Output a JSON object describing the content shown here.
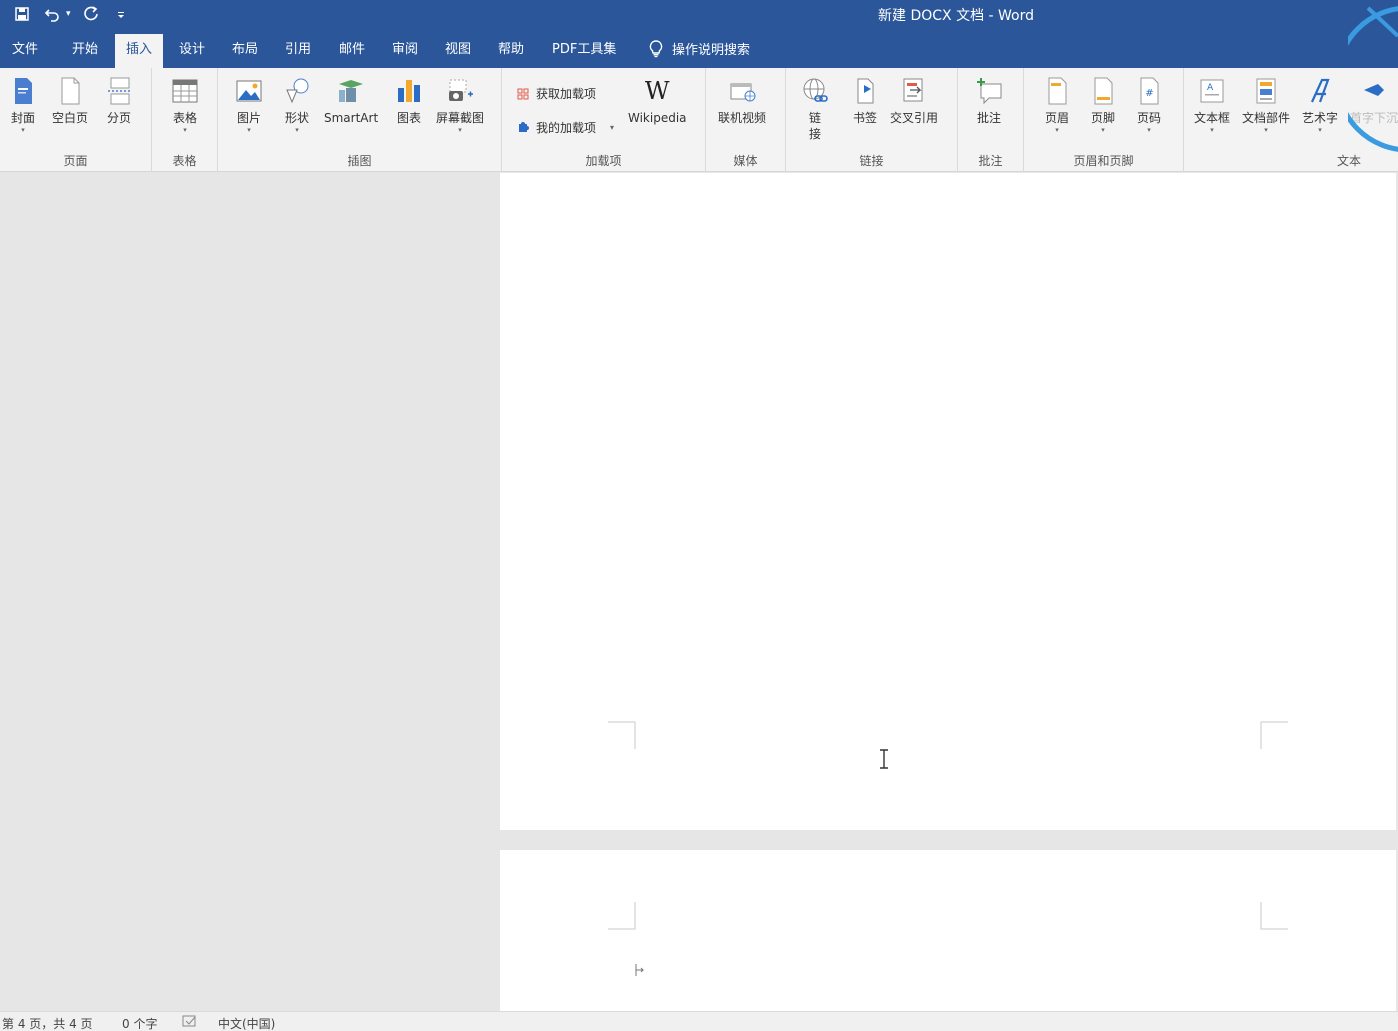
{
  "window": {
    "title": "新建 DOCX 文档  -  Word"
  },
  "quick_access": [
    {
      "name": "save-icon"
    },
    {
      "name": "undo-icon"
    },
    {
      "name": "redo-icon"
    },
    {
      "name": "customize-qat-icon"
    }
  ],
  "tabs": [
    {
      "label": "文件",
      "active": false
    },
    {
      "label": "开始",
      "active": false
    },
    {
      "label": "插入",
      "active": true
    },
    {
      "label": "设计",
      "active": false
    },
    {
      "label": "布局",
      "active": false
    },
    {
      "label": "引用",
      "active": false
    },
    {
      "label": "邮件",
      "active": false
    },
    {
      "label": "审阅",
      "active": false
    },
    {
      "label": "视图",
      "active": false
    },
    {
      "label": "帮助",
      "active": false
    },
    {
      "label": "PDF工具集",
      "active": false
    }
  ],
  "tell_me": {
    "label": "操作说明搜索",
    "icon": "lightbulb-icon"
  },
  "ribbon": {
    "groups": {
      "pages": {
        "label": "页面",
        "buttons": [
          {
            "label": "封面",
            "icon": "cover-page-icon",
            "dropdown": true
          },
          {
            "label": "空白页",
            "icon": "blank-page-icon",
            "dropdown": false
          },
          {
            "label": "分页",
            "icon": "page-break-icon",
            "dropdown": false
          }
        ]
      },
      "tables": {
        "label": "表格",
        "buttons": [
          {
            "label": "表格",
            "icon": "table-icon",
            "dropdown": true
          }
        ]
      },
      "illustrations": {
        "label": "插图",
        "buttons": [
          {
            "label": "图片",
            "icon": "picture-icon",
            "dropdown": true
          },
          {
            "label": "形状",
            "icon": "shapes-icon",
            "dropdown": true
          },
          {
            "label": "SmartArt",
            "icon": "smartart-icon",
            "dropdown": false
          },
          {
            "label": "图表",
            "icon": "chart-icon",
            "dropdown": false
          },
          {
            "label": "屏幕截图",
            "icon": "screenshot-icon",
            "dropdown": true
          }
        ]
      },
      "addins": {
        "label": "加载项",
        "get_addins": "获取加载项",
        "my_addins": "我的加载项",
        "wikipedia": "Wikipedia"
      },
      "media": {
        "label": "媒体",
        "buttons": [
          {
            "label": "联机视频",
            "icon": "online-video-icon"
          }
        ]
      },
      "links": {
        "label": "链接",
        "link_label_top": "链",
        "link_label_bottom": "接",
        "bookmark": "书签",
        "cross_reference": "交叉引用"
      },
      "comments": {
        "label": "批注",
        "buttons": [
          {
            "label": "批注",
            "icon": "comment-icon"
          }
        ]
      },
      "header_footer": {
        "label": "页眉和页脚",
        "buttons": [
          {
            "label": "页眉",
            "icon": "header-icon",
            "dropdown": true
          },
          {
            "label": "页脚",
            "icon": "footer-icon",
            "dropdown": true
          },
          {
            "label": "页码",
            "icon": "page-number-icon",
            "dropdown": true
          }
        ]
      },
      "text": {
        "label": "文本",
        "buttons": [
          {
            "label": "文本框",
            "icon": "text-box-icon",
            "dropdown": true
          },
          {
            "label": "文档部件",
            "icon": "quick-parts-icon",
            "dropdown": true
          },
          {
            "label": "艺术字",
            "icon": "wordart-icon",
            "dropdown": true
          },
          {
            "label": "首字下沉",
            "icon": "drop-cap-icon",
            "dropdown": true
          }
        ]
      }
    }
  },
  "statusbar": {
    "page_info": "第 4 页，共 4 页",
    "word_count": "0 个字",
    "language": "中文(中国)"
  },
  "colors": {
    "accent": "#2b579a",
    "ribbon_bg": "#f3f3f3",
    "workspace_bg": "#e6e6e6"
  }
}
